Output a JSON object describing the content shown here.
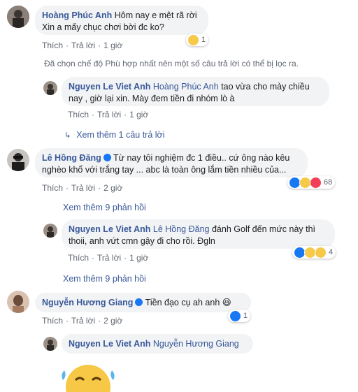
{
  "comments": [
    {
      "author": "Hoàng Phúc Anh",
      "lines": [
        "Hôm nay e mệt rã rời",
        "Xin a mấy chục chơi bời đc ko?"
      ],
      "action_like": "Thích",
      "action_reply": "Trả lời",
      "time": "1 giờ",
      "reaction_count": "1"
    },
    {
      "author": "Lê Hồng Đăng",
      "lines": [
        "Từ nay tôi nghiệm đc 1 điều.. cứ ông nào kêu",
        "nghèo khổ với trắng tay ... abc là toàn ông lắm tiền nhiều của..."
      ],
      "action_like": "Thích",
      "action_reply": "Trả lời",
      "time": "2 giờ",
      "reaction_count": "68"
    },
    {
      "author": "Nguyễn Hương Giang",
      "lines": [
        "Tiền đạo cụ ah anh 😆"
      ],
      "action_like": "Thích",
      "action_reply": "Trả lời",
      "time": "2 giờ",
      "reaction_count": "1"
    }
  ],
  "filter_notice": "Đã chọn chế độ Phù hợp nhất nên một số câu trả lời có thể bị lọc ra.",
  "replies": [
    {
      "author": "Nguyen Le Viet Anh",
      "tag": "Hoàng Phúc Anh",
      "lines": [
        "tao vừa cho mày chiều",
        "nay , giờ lại xin. Mày đem tiền đi nhóm lò à"
      ],
      "action_like": "Thích",
      "action_reply": "Trả lời",
      "time": "1 giờ"
    },
    {
      "author": "Nguyen Le Viet Anh",
      "tag": "Lê Hồng Đăng",
      "lines": [
        "đánh Golf đến mức này thì",
        "thoii, anh vứt cmn gậy đi cho rồi. Đgln"
      ],
      "action_like": "Thích",
      "action_reply": "Trả lời",
      "time": "1 giờ",
      "reaction_count": "4"
    },
    {
      "author": "Nguyen Le Viet Anh",
      "tag": "Nguyễn Hương Giang",
      "lines": []
    }
  ],
  "view_more": [
    "Xem thêm 1 câu trả lời",
    "Xem thêm 9 phản hồi",
    "Xem thêm 9 phản hồi"
  ],
  "colors": {
    "link": "#385898",
    "bubble": "#f2f3f5",
    "meta": "#606770",
    "like_blue": "#1877f2"
  }
}
